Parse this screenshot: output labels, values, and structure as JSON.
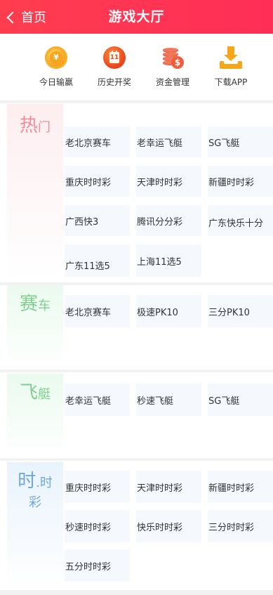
{
  "header": {
    "back_label": "首页",
    "title": "游戏大厅"
  },
  "quicknav": [
    {
      "label": "今日输赢",
      "icon": "coin-icon",
      "glyph": "¥"
    },
    {
      "label": "历史开奖",
      "icon": "calendar-icon",
      "glyph": "11"
    },
    {
      "label": "资金管理",
      "icon": "money-stack-icon",
      "glyph": "$"
    },
    {
      "label": "下载APP",
      "icon": "download-icon"
    }
  ],
  "sections": [
    {
      "title_big": "热",
      "title_small": "门",
      "title_color": "#f08b98",
      "games": [
        "老北京赛车",
        "老幸运飞艇",
        "SG飞艇",
        "重庆时时彩",
        "天津时时彩",
        "新疆时时彩",
        "广西快3",
        "腾讯分分彩",
        "广东快乐十分",
        "广东11选5",
        "上海11选5"
      ]
    },
    {
      "title_big": "赛",
      "title_small": "车",
      "title_color": "#7fd08e",
      "games": [
        "老北京赛车",
        "极速PK10",
        "三分PK10"
      ]
    },
    {
      "title_big": "飞",
      "title_small": "艇",
      "title_color": "#7fd08e",
      "games": [
        "老幸运飞艇",
        "秒速飞艇",
        "SG飞艇"
      ]
    },
    {
      "title_big": "时",
      "title_small": ".时",
      "title_small2": "彩",
      "title_color": "#6fa8dc",
      "games": [
        "重庆时时彩",
        "天津时时彩",
        "新疆时时彩",
        "秒速时时彩",
        "快乐时时彩",
        "三分时时彩",
        "五分时时彩"
      ]
    }
  ],
  "colors": {
    "header_gradient": [
      "#ff3d4f",
      "#ff2e57"
    ],
    "cell_background": "#f5f9fe",
    "hot_gradient": "#fdeef0",
    "race_gradient": "#eafaee",
    "boat_gradient": "#eafaee",
    "ssc_gradient": "#e9f3fc"
  }
}
